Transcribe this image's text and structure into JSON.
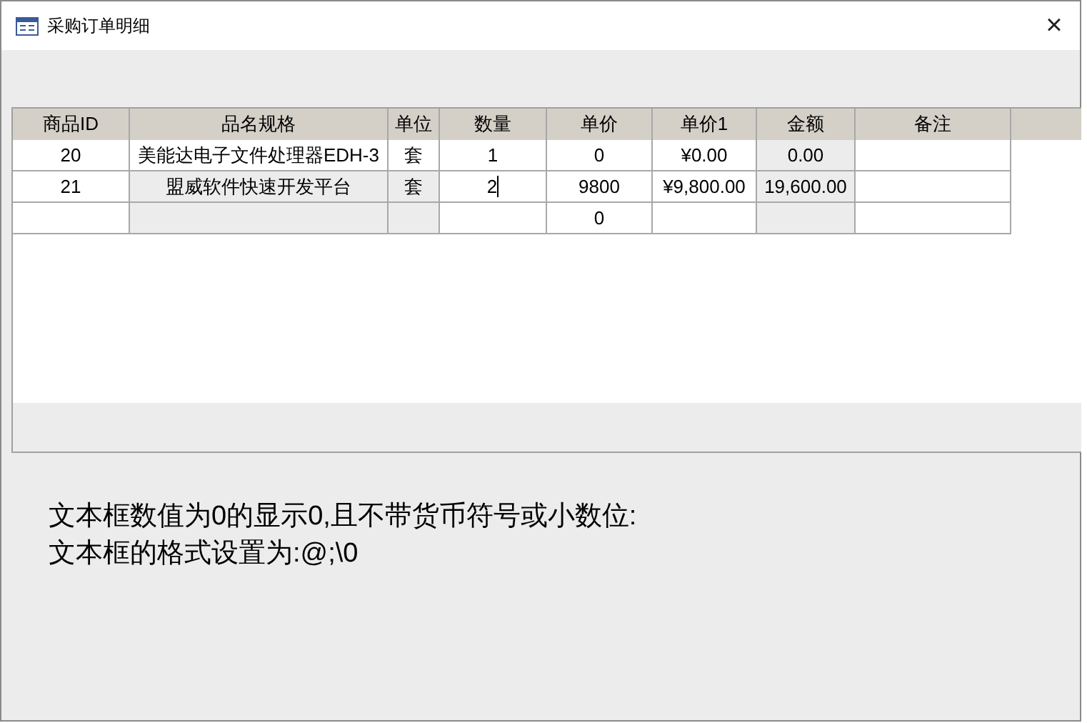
{
  "window": {
    "title": "采购订单明细",
    "close": "×"
  },
  "table": {
    "columns": [
      "商品ID",
      "品名规格",
      "单位",
      "数量",
      "单价",
      "单价1",
      "金额",
      "备注"
    ],
    "rows": [
      [
        {
          "text": "20",
          "shaded": false
        },
        {
          "text": "美能达电子文件处理器EDH-3",
          "shaded": false
        },
        {
          "text": "套",
          "shaded": false
        },
        {
          "text": "1",
          "shaded": false
        },
        {
          "text": "0",
          "shaded": false
        },
        {
          "text": "¥0.00",
          "shaded": false
        },
        {
          "text": "0.00",
          "shaded": true
        },
        {
          "shaded": false
        }
      ],
      [
        {
          "text": "21",
          "shaded": false
        },
        {
          "text": "盟威软件快速开发平台",
          "shaded": true
        },
        {
          "text": "套",
          "shaded": true
        },
        {
          "text": "2",
          "shaded": false,
          "editing": true
        },
        {
          "text": "9800",
          "shaded": false
        },
        {
          "text": "¥9,800.00",
          "shaded": false
        },
        {
          "text": "19,600.00",
          "shaded": true
        },
        {
          "shaded": false
        }
      ],
      [
        {
          "shaded": false
        },
        {
          "shaded": true
        },
        {
          "shaded": true
        },
        {
          "shaded": false
        },
        {
          "text": "0",
          "shaded": false
        },
        {
          "shaded": false
        },
        {
          "shaded": true
        },
        {
          "shaded": false
        }
      ]
    ]
  },
  "note": [
    "文本框数值为0的显示0,且不带货币符号或小数位:",
    "文本框的格式设置为:@;\\0"
  ]
}
